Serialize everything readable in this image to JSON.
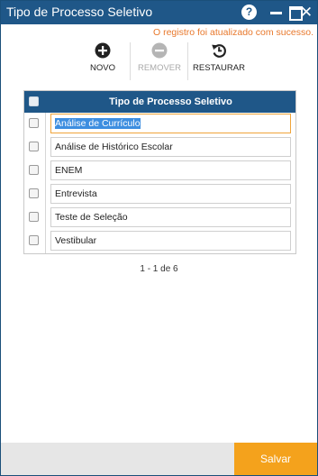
{
  "window": {
    "title": "Tipo de Processo Seletivo",
    "help_label": "?",
    "close_label": "✕"
  },
  "status_message": "O registro foi atualizado com sucesso.",
  "toolbar": {
    "novo_label": "NOVO",
    "remover_label": "REMOVER",
    "restaurar_label": "RESTAURAR"
  },
  "grid": {
    "header": "Tipo de Processo Seletivo",
    "rows": [
      "Análise de Currículo",
      "Análise de Histórico Escolar",
      "ENEM",
      "Entrevista",
      "Teste de Seleção",
      "Vestibular"
    ]
  },
  "pager": "1 - 1 de 6",
  "footer": {
    "save_label": "Salvar"
  },
  "colors": {
    "titlebar": "#1f5788",
    "status": "#e8782c",
    "save": "#f4a21c",
    "selection": "#3d8ee0"
  }
}
